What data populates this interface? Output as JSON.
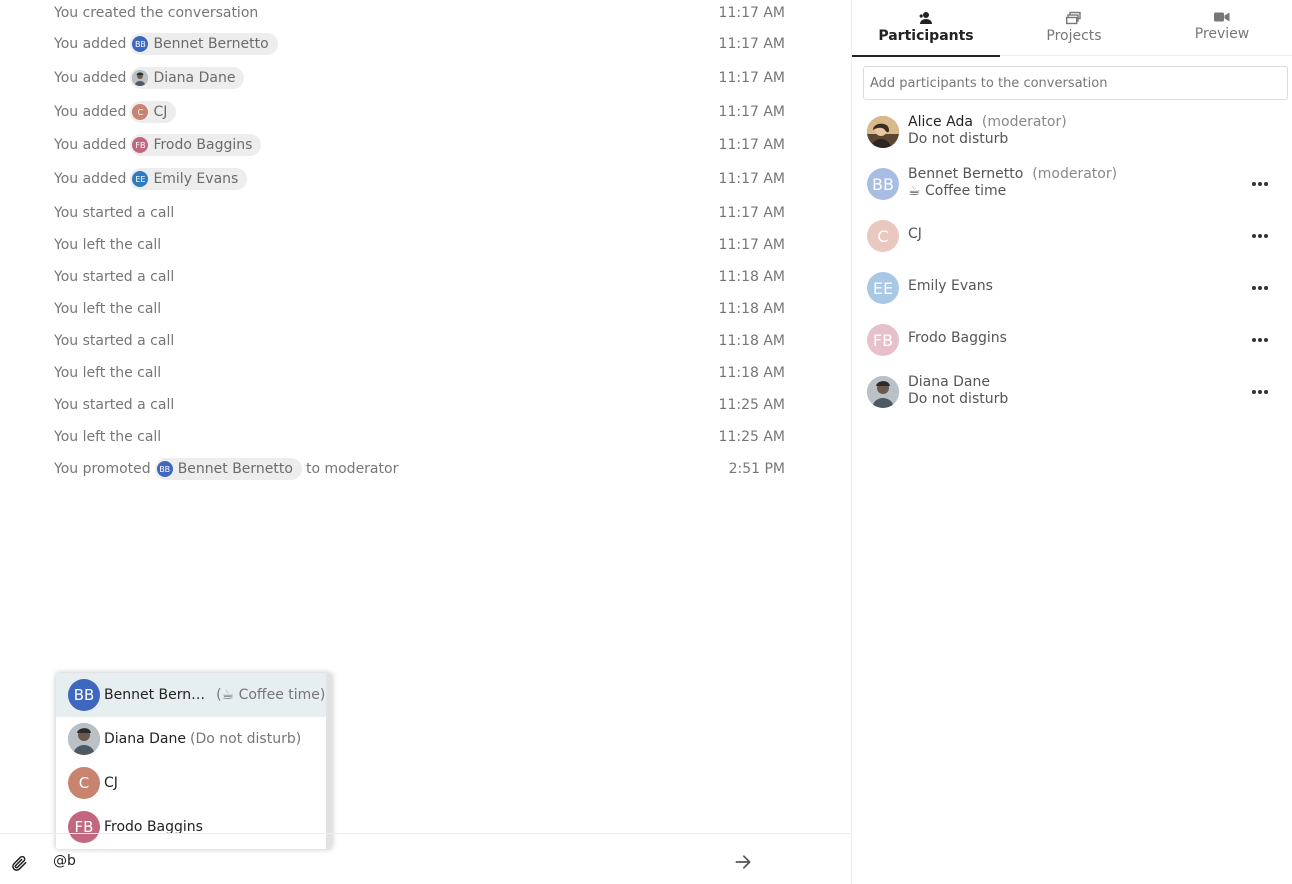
{
  "chat": {
    "messages": [
      {
        "prefix": "You created the conversation",
        "time": "11:17 AM"
      },
      {
        "prefix": "You added",
        "chip": {
          "initials": "BB",
          "name": "Bennet Bernetto",
          "color": "#3e67bf"
        },
        "time": "11:17 AM"
      },
      {
        "prefix": "You added",
        "chip": {
          "initials": "",
          "name": "Diana Dane",
          "color": "#7a8a95"
        },
        "time": "11:17 AM"
      },
      {
        "prefix": "You added",
        "chip": {
          "initials": "C",
          "name": "CJ",
          "color": "#c9846f"
        },
        "time": "11:17 AM"
      },
      {
        "prefix": "You added",
        "chip": {
          "initials": "FB",
          "name": "Frodo Baggins",
          "color": "#c2687e"
        },
        "time": "11:17 AM"
      },
      {
        "prefix": "You added",
        "chip": {
          "initials": "EE",
          "name": "Emily Evans",
          "color": "#2e7bbf"
        },
        "time": "11:17 AM"
      },
      {
        "prefix": "You started a call",
        "time": "11:17 AM"
      },
      {
        "prefix": "You left the call",
        "time": "11:17 AM"
      },
      {
        "prefix": "You started a call",
        "time": "11:18 AM"
      },
      {
        "prefix": "You left the call",
        "time": "11:18 AM"
      },
      {
        "prefix": "You started a call",
        "time": "11:18 AM"
      },
      {
        "prefix": "You left the call",
        "time": "11:18 AM"
      },
      {
        "prefix": "You started a call",
        "time": "11:25 AM"
      },
      {
        "prefix": "You left the call",
        "time": "11:25 AM"
      },
      {
        "prefix": "You promoted",
        "chip": {
          "initials": "BB",
          "name": "Bennet Bernetto",
          "color": "#3e67bf"
        },
        "suffix": "to moderator",
        "time": "2:51 PM"
      }
    ]
  },
  "mention_popup": {
    "items": [
      {
        "initials": "BB",
        "name": "Bennet Bern…",
        "status": "(☕ Coffee time)",
        "color": "#3e67bf",
        "active": true
      },
      {
        "initials": "",
        "name": "Diana Dane",
        "status": "(Do not disturb)",
        "color": "#7a8a95",
        "active": false
      },
      {
        "initials": "C",
        "name": "CJ",
        "status": "",
        "color": "#c9846f",
        "active": false
      },
      {
        "initials": "FB",
        "name": "Frodo Baggins",
        "status": "",
        "color": "#c2687e",
        "active": false
      }
    ]
  },
  "composer": {
    "value": "@b"
  },
  "sidebar": {
    "tabs": [
      {
        "label": "Participants",
        "icon": "participants-icon",
        "active": true
      },
      {
        "label": "Projects",
        "icon": "projects-icon",
        "active": false
      },
      {
        "label": "Preview",
        "icon": "video-icon",
        "active": false
      }
    ],
    "add_placeholder": "Add participants to the conversation",
    "participants": [
      {
        "name": "Alice Ada",
        "role": "(moderator)",
        "status": "Do not disturb",
        "initials": "",
        "color": "#8a6d4a",
        "photo": true,
        "more": false
      },
      {
        "name": "Bennet Bernetto",
        "role": "(moderator)",
        "status": "☕ Coffee time",
        "initials": "BB",
        "color": "#a9bde3",
        "photo": false,
        "more": true
      },
      {
        "name": "CJ",
        "role": "",
        "status": "",
        "initials": "C",
        "color": "#e9c8bf",
        "photo": false,
        "more": true
      },
      {
        "name": "Emily Evans",
        "role": "",
        "status": "",
        "initials": "EE",
        "color": "#a8c8e6",
        "photo": false,
        "more": true
      },
      {
        "name": "Frodo Baggins",
        "role": "",
        "status": "",
        "initials": "FB",
        "color": "#e6c1cb",
        "photo": false,
        "more": true
      },
      {
        "name": "Diana Dane",
        "role": "",
        "status": "Do not disturb",
        "initials": "",
        "color": "#b9c1c6",
        "photo": true,
        "more": true
      }
    ]
  }
}
